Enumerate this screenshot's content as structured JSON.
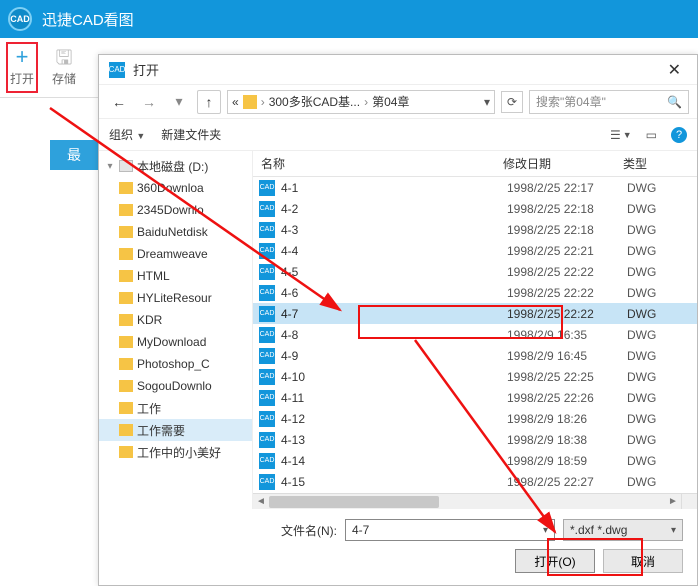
{
  "app": {
    "title": "迅捷CAD看图",
    "icon_text": "CAD"
  },
  "main_toolbar": {
    "open": "打开",
    "save": "存储",
    "left_stub": "最"
  },
  "dialog": {
    "title": "打开",
    "icon_text": "CAD",
    "close_glyph": "✕",
    "nav": {
      "back_glyph": "←",
      "fwd_glyph": "→",
      "dropdown_glyph": "▾",
      "up_glyph": "↑",
      "refresh_glyph": "⟳",
      "breadcrumb": [
        "300多张CAD基...",
        "第04章"
      ],
      "sep": "›",
      "ellipsis": "«",
      "search_placeholder": "搜索\"第04章\"",
      "search_icon": "🔍"
    },
    "toolbar": {
      "organize": "组织",
      "new_folder": "新建文件夹",
      "view_icon": "☰",
      "view_icon2": "▭",
      "help": "?"
    },
    "columns": {
      "name": "名称",
      "date": "修改日期",
      "type": "类型"
    },
    "tree": [
      {
        "label": "本地磁盘 (D:)",
        "drive": true,
        "chev": "▾"
      },
      {
        "label": "360Downloa"
      },
      {
        "label": "2345Downlo"
      },
      {
        "label": "BaiduNetdisk"
      },
      {
        "label": "Dreamweave"
      },
      {
        "label": "HTML"
      },
      {
        "label": "HYLiteResour"
      },
      {
        "label": "KDR"
      },
      {
        "label": "MyDownload"
      },
      {
        "label": "Photoshop_C"
      },
      {
        "label": "SogouDownlo"
      },
      {
        "label": "工作"
      },
      {
        "label": "工作需要",
        "sel": true
      },
      {
        "label": "工作中的小美好"
      }
    ],
    "files": [
      {
        "name": "4-1",
        "date": "1998/2/25 22:17",
        "type": "DWG"
      },
      {
        "name": "4-2",
        "date": "1998/2/25 22:18",
        "type": "DWG"
      },
      {
        "name": "4-3",
        "date": "1998/2/25 22:18",
        "type": "DWG"
      },
      {
        "name": "4-4",
        "date": "1998/2/25 22:21",
        "type": "DWG"
      },
      {
        "name": "4-5",
        "date": "1998/2/25 22:22",
        "type": "DWG"
      },
      {
        "name": "4-6",
        "date": "1998/2/25 22:22",
        "type": "DWG"
      },
      {
        "name": "4-7",
        "date": "1998/2/25 22:22",
        "type": "DWG",
        "sel": true
      },
      {
        "name": "4-8",
        "date": "1998/2/9 16:35",
        "type": "DWG"
      },
      {
        "name": "4-9",
        "date": "1998/2/9 16:45",
        "type": "DWG"
      },
      {
        "name": "4-10",
        "date": "1998/2/25 22:25",
        "type": "DWG"
      },
      {
        "name": "4-11",
        "date": "1998/2/25 22:26",
        "type": "DWG"
      },
      {
        "name": "4-12",
        "date": "1998/2/9 18:26",
        "type": "DWG"
      },
      {
        "name": "4-13",
        "date": "1998/2/9 18:38",
        "type": "DWG"
      },
      {
        "name": "4-14",
        "date": "1998/2/9 18:59",
        "type": "DWG"
      },
      {
        "name": "4-15",
        "date": "1998/2/25 22:27",
        "type": "DWG"
      }
    ],
    "footer": {
      "filename_label": "文件名(N):",
      "filename_value": "4-7",
      "filter_value": "*.dxf *.dwg",
      "open_btn": "打开(O)",
      "cancel_btn": "取消"
    }
  }
}
